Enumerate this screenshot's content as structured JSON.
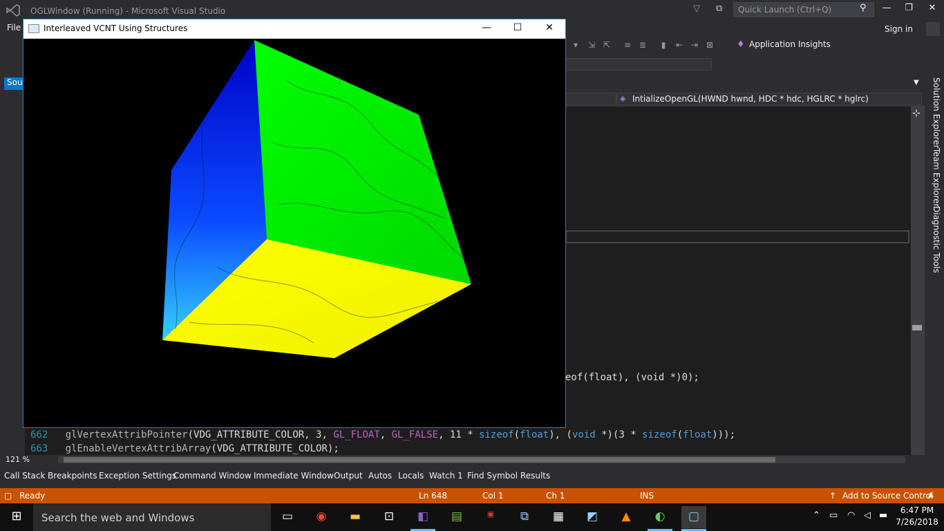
{
  "vs": {
    "title": "OGLWindow (Running) - Microsoft Visual Studio",
    "quick_launch_placeholder": "Quick Launch (Ctrl+Q)",
    "menu_file": "File",
    "sign_in": "Sign in",
    "app_insights": "Application Insights",
    "source_tab": "Sour",
    "nav_function": "IntializeOpenGL(HWND hwnd, HDC * hdc, HGLRC * hglrc)",
    "zoom": "121 %",
    "code": {
      "partial_line": "eof(float), (void *)0);",
      "line662_num": "662",
      "line663_num": "663"
    },
    "right_tabs": [
      "Solution Explorer",
      "Team Explorer",
      "Diagnostic Tools"
    ],
    "bottom_tabs": [
      "Call Stack",
      "Breakpoints",
      "Exception Settings",
      "Command Window",
      "Immediate Window",
      "Output",
      "Autos",
      "Locals",
      "Watch 1",
      "Find Symbol Results"
    ],
    "status": {
      "ready": "Ready",
      "ln": "Ln 648",
      "col": "Col 1",
      "ch": "Ch 1",
      "ins": "INS",
      "source_control": "Add to Source Control"
    }
  },
  "gl_window": {
    "title": "Interleaved VCNT Using Structures"
  },
  "taskbar": {
    "search_placeholder": "Search the web and Windows",
    "time": "6:47 PM",
    "date": "7/26/2018"
  },
  "colors": {
    "status_bar": "#ca5100",
    "accent": "#007acc",
    "cube_top": "#00ff00",
    "cube_left": "#0000ff",
    "cube_bottom": "#ffff00"
  }
}
